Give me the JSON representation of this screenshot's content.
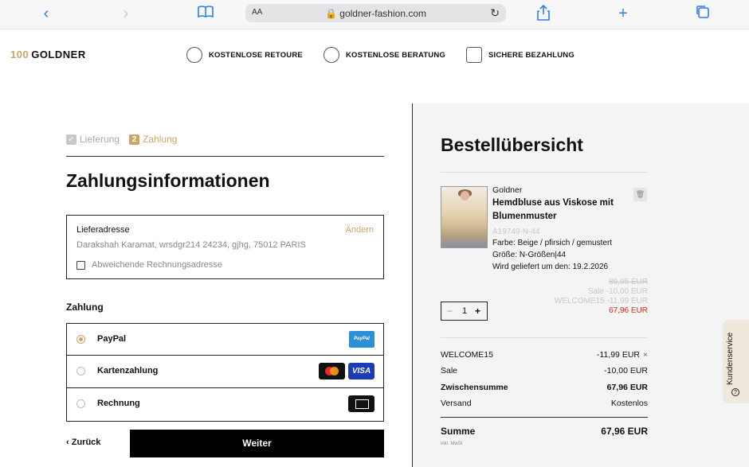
{
  "browser": {
    "aa_label": "AA",
    "url": "goldner-fashion.com"
  },
  "header": {
    "logo_prefix": "100",
    "logo_text": "GOLDNER",
    "usps": [
      "KOSTENLOSE RETOURE",
      "KOSTENLOSE BERATUNG",
      "SICHERE BEZAHLUNG"
    ]
  },
  "checkout": {
    "steps": [
      {
        "num": "✓",
        "label": "Lieferung"
      },
      {
        "num": "2",
        "label": "Zahlung"
      }
    ],
    "title": "Zahlungsinformationen",
    "address": {
      "label": "Lieferadresse",
      "change": "Ändern",
      "value": "Darakshah Karamat, wrsdgr214 24234, gjhg, 75012 PARIS",
      "alt_billing": "Abweichende Rechnungsadresse"
    },
    "payment_heading": "Zahlung",
    "payment_options": [
      "PayPal",
      "Kartenzahlung",
      "Rechnung"
    ],
    "paypal_logo": "PayPal",
    "visa_logo": "VISA",
    "back": "Zurück",
    "next": "Weiter"
  },
  "summary": {
    "title": "Bestellübersicht",
    "item": {
      "brand": "Goldner",
      "name": "Hemdbluse aus Viskose mit Blumenmuster",
      "article": "A19749-N-44",
      "color": "Farbe: Beige / pfirsich / gemustert",
      "size": "Größe: N-Größen|44",
      "delivery": "Wird geliefert um den: 19.2.2026",
      "price_original": "89,95 EUR",
      "price_sale": "Sale  -10,00 EUR",
      "price_welcome": "WELCOME15  -11,99 EUR",
      "price_final": "67,96 EUR",
      "quantity": "1"
    },
    "rows": [
      {
        "label": "WELCOME15",
        "value": "-11,99 EUR"
      },
      {
        "label": "Sale",
        "value": "-10,00 EUR"
      },
      {
        "label": "Zwischensumme",
        "value": "67,96 EUR"
      },
      {
        "label": "Versand",
        "value": "Kostenlos"
      }
    ],
    "total_label": "Summe",
    "total_value": "67,96 EUR",
    "vat_note": "inkl. MwSt"
  },
  "service": {
    "label": "Kundenservice"
  }
}
